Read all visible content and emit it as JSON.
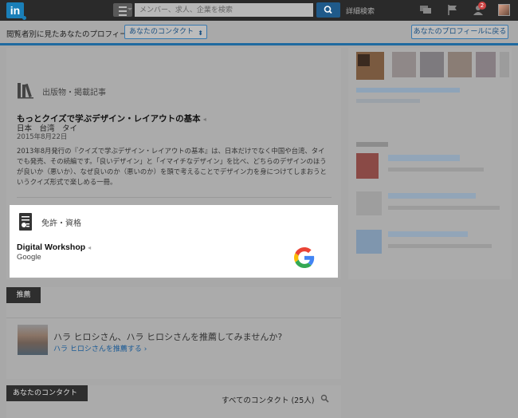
{
  "nav": {
    "logo": "in",
    "search_placeholder": "メンバー、求人、企業を検索",
    "advanced_search": "詳細検索",
    "notification_count": "2",
    "icons": [
      "menu-icon",
      "search-icon",
      "messages-icon",
      "flag-icon",
      "add-connection-icon",
      "avatar"
    ]
  },
  "context_bar": {
    "label": "閲覧者別に見たあなたのプロフィール",
    "selected_view": "あなたのコンタクト",
    "back_button": "あなたのプロフィールに戻る"
  },
  "publications": {
    "heading": "出版物・掲載記事",
    "title": "もっとクイズで学ぶデザイン・レイアウトの基本",
    "publisher": "日本　台湾　タイ",
    "date": "2015年8月22日",
    "description": "2013年8月発行の『クイズで学ぶデザイン・レイアウトの基本』は、日本だけでなく中国や台湾、タイでも発売、その続編です。「良いデザイン」と「イマイチなデザイン」を比べ、どちらのデザインのほうが良いか（悪いか）、なぜ良いのか（悪いのか）を頭で考えることでデザイン力を身につけてしまおうというクイズ形式で楽しめる一冊。"
  },
  "licenses": {
    "heading": "免許・資格",
    "name": "Digital Workshop",
    "issuer": "Google"
  },
  "recommendations": {
    "tag": "推薦",
    "prompt": "ハラ ヒロシさん、ハラ ヒロシさんを推薦してみませんか?",
    "link": "ハラ ヒロシさんを推薦する ›"
  },
  "contacts": {
    "tag": "あなたのコンタクト",
    "all_label": "すべてのコンタクト (25人)"
  },
  "colors": {
    "brand_blue": "#1a7fb8",
    "accent_bar": "#1f6aa0",
    "google_blue": "#4285F4",
    "google_red": "#EA4335",
    "google_yellow": "#FBBC05",
    "google_green": "#34A853"
  }
}
